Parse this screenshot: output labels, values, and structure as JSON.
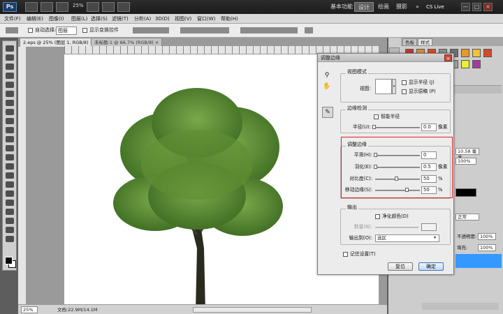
{
  "titlebar": {
    "logo": "Ps",
    "zoom": "25%",
    "workspaces": [
      "基本功能",
      "设计",
      "绘画",
      "摄影"
    ],
    "active_workspace": "设计",
    "more": "»",
    "cs_live": "CS Live",
    "window_buttons": [
      "—",
      "□",
      "×"
    ]
  },
  "menubar": [
    "文件(F)",
    "编辑(E)",
    "图像(I)",
    "图层(L)",
    "选择(S)",
    "滤镜(T)",
    "分析(A)",
    "3D(D)",
    "视图(V)",
    "窗口(W)",
    "帮助(H)"
  ],
  "options_bar": {
    "auto_select_label": "自动选择:",
    "auto_select_value": "图层",
    "show_transform_label": "显示变换控件"
  },
  "documents": {
    "tabs": [
      "2.eps @ 25% (图层 1, RGB/8) ×",
      "未标题-1 @ 66.7% (RGB/8) ×"
    ],
    "active": 0
  },
  "status": {
    "zoom": "25%",
    "doc_size": "文档:22.9M/14.1M"
  },
  "right_panel": {
    "tabs": [
      "色板",
      "样式"
    ],
    "active_tab": "样式",
    "fields": {
      "size": "10.58 毫米",
      "percent1": "100%",
      "blend": "正常",
      "opacity_label": "不透明度:",
      "opacity": "100%",
      "fill_label": "填充:",
      "fill": "100%"
    },
    "colors": {
      "swatches": [
        "#c0392b",
        "#e08a2c",
        "#d94b1e",
        "#8a8a8a",
        "#6f6f6f",
        "#e59b2a",
        "#f2c230",
        "#cf4b2a",
        "#b2b2b2",
        "#4c6e9e",
        "#d8d8d8",
        "#8bc34a",
        "#9e9e9e",
        "#ecec3a",
        "#a13c9e"
      ],
      "layer_highlight": "#3399ff"
    }
  },
  "dialog": {
    "title": "调整边缘",
    "close": "×",
    "view_mode": {
      "group": "视图模式",
      "view_label": "视图:",
      "show_radius": "显示半径 (J)",
      "show_original": "显示原稿 (P)"
    },
    "edge_detection": {
      "group": "边缘检测",
      "smart_radius": "智能半径",
      "radius_label": "半径(U):",
      "radius_value": "0.0",
      "radius_unit": "像素"
    },
    "adjust_edge": {
      "group": "调整边缘",
      "rows": [
        {
          "label": "平滑(H):",
          "value": "0",
          "unit": "",
          "level": 0.0
        },
        {
          "label": "羽化(E):",
          "value": "0.5",
          "unit": "像素",
          "level": 0.0
        },
        {
          "label": "对比度(C):",
          "value": "50",
          "unit": "%",
          "level": 0.5
        },
        {
          "label": "移动边缘(S):",
          "value": "50",
          "unit": "%",
          "level": 0.75
        }
      ],
      "highlight_color": "#e02020"
    },
    "output": {
      "group": "输出",
      "decontaminate": "净化颜色(D)",
      "amount_label": "数量(N):",
      "output_to_label": "输出到(O):",
      "output_to_value": "选区"
    },
    "remember": "记住设置(T)",
    "reset_button": "复位",
    "ok_button": "确定"
  }
}
